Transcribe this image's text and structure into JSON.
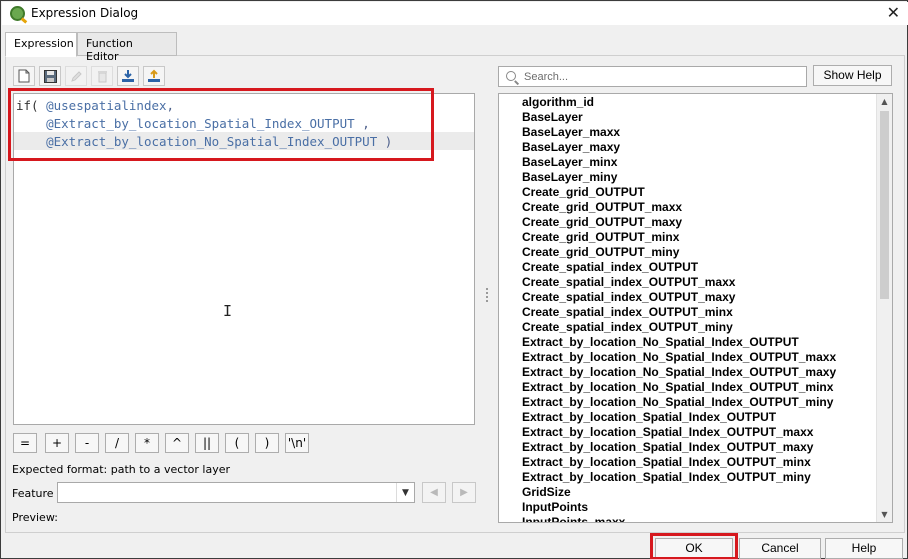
{
  "window": {
    "title": "Expression Dialog",
    "close_symbol": "✕"
  },
  "tabs": [
    {
      "label": "Expression",
      "active": true
    },
    {
      "label": "Function Editor",
      "active": false
    }
  ],
  "toolbar": {
    "icons": [
      "new-file-icon",
      "save-icon",
      "edit-icon",
      "delete-icon",
      "import-icon",
      "export-icon"
    ]
  },
  "editor": {
    "lines": [
      {
        "prefix": "if( ",
        "var": "@usespatialindex",
        "suffix": ","
      },
      {
        "prefix": "    ",
        "var": "@Extract_by_location_Spatial_Index_OUTPUT",
        "suffix": " ,"
      },
      {
        "prefix": "    ",
        "var": "@Extract_by_location_No_Spatial_Index_OUTPUT",
        "suffix": " )"
      }
    ]
  },
  "operators": [
    "=",
    "+",
    "-",
    "/",
    "*",
    "^",
    "||",
    "(",
    ")",
    "'\\n'"
  ],
  "expected_format": {
    "label": "Expected format:",
    "value": "path to a vector layer"
  },
  "feature": {
    "label": "Feature",
    "value": ""
  },
  "preview": {
    "label": "Preview:"
  },
  "search": {
    "placeholder": "Search...",
    "value": ""
  },
  "show_help_label": "Show Help",
  "variables": [
    "algorithm_id",
    "BaseLayer",
    "BaseLayer_maxx",
    "BaseLayer_maxy",
    "BaseLayer_minx",
    "BaseLayer_miny",
    "Create_grid_OUTPUT",
    "Create_grid_OUTPUT_maxx",
    "Create_grid_OUTPUT_maxy",
    "Create_grid_OUTPUT_minx",
    "Create_grid_OUTPUT_miny",
    "Create_spatial_index_OUTPUT",
    "Create_spatial_index_OUTPUT_maxx",
    "Create_spatial_index_OUTPUT_maxy",
    "Create_spatial_index_OUTPUT_minx",
    "Create_spatial_index_OUTPUT_miny",
    "Extract_by_location_No_Spatial_Index_OUTPUT",
    "Extract_by_location_No_Spatial_Index_OUTPUT_maxx",
    "Extract_by_location_No_Spatial_Index_OUTPUT_maxy",
    "Extract_by_location_No_Spatial_Index_OUTPUT_minx",
    "Extract_by_location_No_Spatial_Index_OUTPUT_miny",
    "Extract_by_location_Spatial_Index_OUTPUT",
    "Extract_by_location_Spatial_Index_OUTPUT_maxx",
    "Extract_by_location_Spatial_Index_OUTPUT_maxy",
    "Extract_by_location_Spatial_Index_OUTPUT_minx",
    "Extract_by_location_Spatial_Index_OUTPUT_miny",
    "GridSize",
    "InputPoints",
    "InputPoints_maxx"
  ],
  "buttons": {
    "ok": "OK",
    "cancel": "Cancel",
    "help": "Help"
  },
  "colors": {
    "highlight_box": "#d6181e",
    "code_variable": "#4a6fa5"
  }
}
